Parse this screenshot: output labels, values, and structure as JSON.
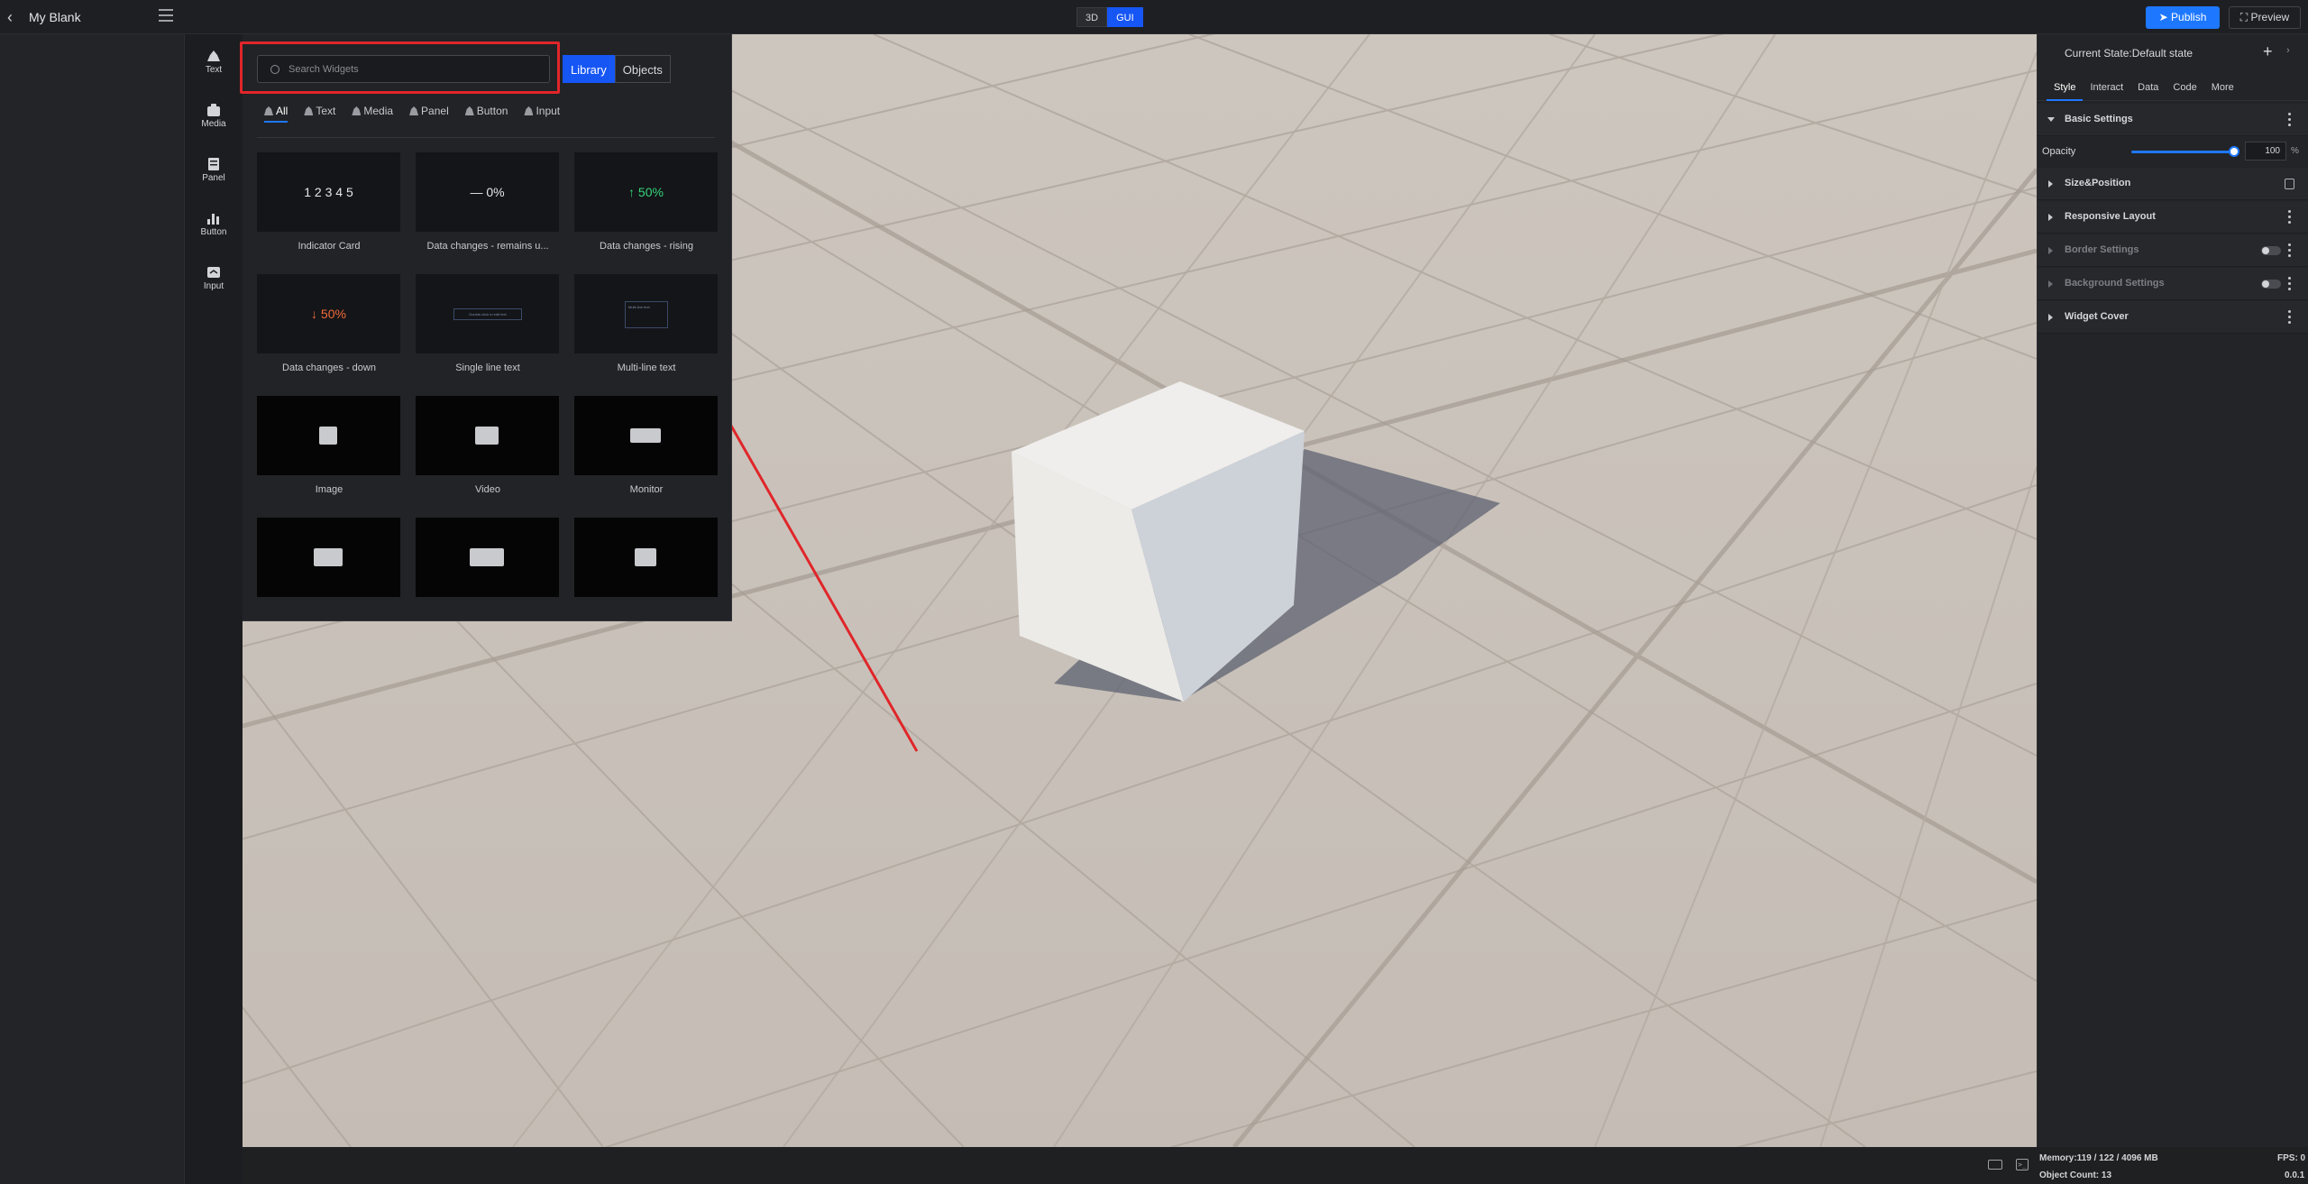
{
  "header": {
    "project_title": "My Blank",
    "modes": [
      "3D",
      "GUI"
    ],
    "active_mode": "GUI",
    "publish_label": "Publish",
    "preview_label": "Preview"
  },
  "rail": {
    "items": [
      {
        "label": "Text",
        "icon": "text-icon"
      },
      {
        "label": "Media",
        "icon": "media-icon"
      },
      {
        "label": "Panel",
        "icon": "panel-icon"
      },
      {
        "label": "Button",
        "icon": "button-icon"
      },
      {
        "label": "Input",
        "icon": "input-icon"
      }
    ]
  },
  "widget_panel": {
    "search_placeholder": "Search Widgets",
    "library_tab": "Library",
    "objects_tab": "Objects",
    "filters": [
      "All",
      "Text",
      "Media",
      "Panel",
      "Button",
      "Input"
    ],
    "active_filter": "All",
    "cards": [
      {
        "label": "Indicator Card",
        "preview": "1 2 3 4 5"
      },
      {
        "label": "Data changes - remains u...",
        "preview": "— 0%"
      },
      {
        "label": "Data changes - rising",
        "preview": "↑ 50%"
      },
      {
        "label": "Data changes - down",
        "preview": "↓ 50%"
      },
      {
        "label": "Single line text",
        "preview": "Double-click to edit text"
      },
      {
        "label": "Multi-line text",
        "preview": "Multi-line text"
      },
      {
        "label": "Image",
        "preview": ""
      },
      {
        "label": "Video",
        "preview": ""
      },
      {
        "label": "Monitor",
        "preview": ""
      },
      {
        "label": "",
        "preview": ""
      },
      {
        "label": "",
        "preview": ""
      },
      {
        "label": "",
        "preview": ""
      }
    ]
  },
  "properties": {
    "current_state": "Current State:Default state",
    "tabs": [
      "Style",
      "Interact",
      "Data",
      "Code",
      "More"
    ],
    "active_tab": "Style",
    "sections": {
      "basic": "Basic Settings",
      "size": "Size&Position",
      "responsive": "Responsive Layout",
      "border": "Border Settings",
      "background": "Background Settings",
      "cover": "Widget Cover"
    },
    "opacity_label": "Opacity",
    "opacity_value": "100",
    "opacity_unit": "%",
    "opacity_fraction": 1.0
  },
  "status": {
    "memory": "Memory:119 / 122 / 4096 MB",
    "fps": "FPS: 0",
    "object_count": "Object Count: 13",
    "version": "0.0.1"
  },
  "colors": {
    "accent": "#1656f5",
    "publish": "#1e78ff",
    "highlight": "#e0262a",
    "rising": "#35d47a",
    "falling": "#f26b3a"
  }
}
